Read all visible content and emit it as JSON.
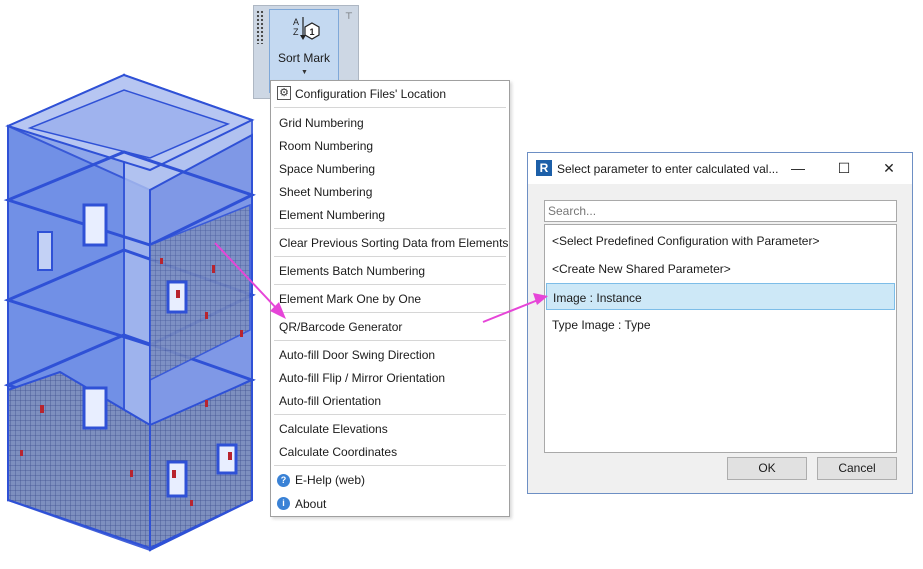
{
  "ribbon": {
    "button_label": "Sort Mark"
  },
  "menu": {
    "items": [
      "Configuration Files' Location",
      "Grid Numbering",
      "Room Numbering",
      "Space Numbering",
      "Sheet Numbering",
      "Element Numbering",
      "Clear Previous Sorting Data from Elements",
      "Elements Batch Numbering",
      "Element Mark One by One",
      "QR/Barcode Generator",
      "Auto-fill Door Swing Direction",
      "Auto-fill Flip / Mirror Orientation",
      "Auto-fill Orientation",
      "Calculate Elevations",
      "Calculate Coordinates",
      "E-Help (web)",
      "About"
    ]
  },
  "dialog": {
    "title": "Select parameter to enter calculated val...",
    "search_placeholder": "Search...",
    "list": [
      "<Select Predefined Configuration with Parameter>",
      "<Create New Shared Parameter>",
      "Image : Instance",
      "Type Image : Type"
    ],
    "selected_index": 2,
    "ok_label": "OK",
    "cancel_label": "Cancel"
  },
  "colors": {
    "model_blue": "#3d63e8",
    "selection_bg": "#cde8f7",
    "arrow": "#e645d8",
    "ribbon_bg": "#cdd7e4"
  }
}
